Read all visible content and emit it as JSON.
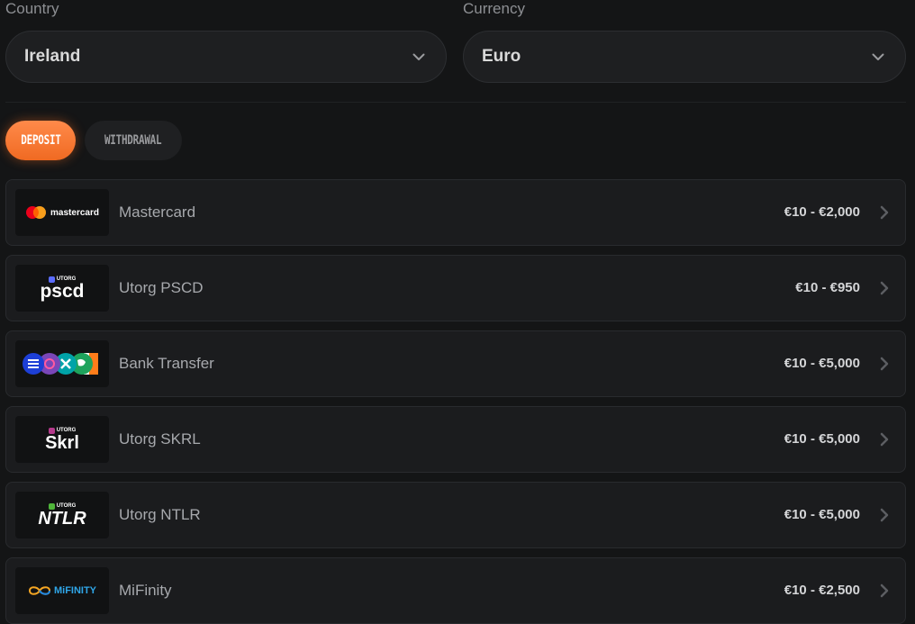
{
  "country": {
    "label": "Country",
    "value": "Ireland"
  },
  "currency": {
    "label": "Currency",
    "value": "Euro"
  },
  "tabs": {
    "deposit": "DEPOSIT",
    "withdrawal": "WITHDRAWAL"
  },
  "colors": {
    "accent": "#f06a22",
    "background": "#141516",
    "card": "#1b1c1e"
  },
  "methods": [
    {
      "name": "Mastercard",
      "range": "€10 - €2,000",
      "logo_text": "mastercard",
      "icon": "mastercard-logo"
    },
    {
      "name": "Utorg PSCD",
      "range": "€10 - €950",
      "logo_badge": "UTORG",
      "logo_text": "pscd",
      "icon": "utorg-pscd-logo"
    },
    {
      "name": "Bank Transfer",
      "range": "€10 - €5,000",
      "icon": "bank-transfer-logos"
    },
    {
      "name": "Utorg SKRL",
      "range": "€10 - €5,000",
      "logo_badge": "UTORG",
      "logo_text": "Skrl",
      "icon": "utorg-skrl-logo"
    },
    {
      "name": "Utorg NTLR",
      "range": "€10 - €5,000",
      "logo_badge": "UTORG",
      "logo_text": "NTLR",
      "icon": "utorg-ntlr-logo"
    },
    {
      "name": "MiFinity",
      "range": "€10 - €2,500",
      "logo_text": "MiFINITY",
      "icon": "mifinity-logo"
    }
  ]
}
